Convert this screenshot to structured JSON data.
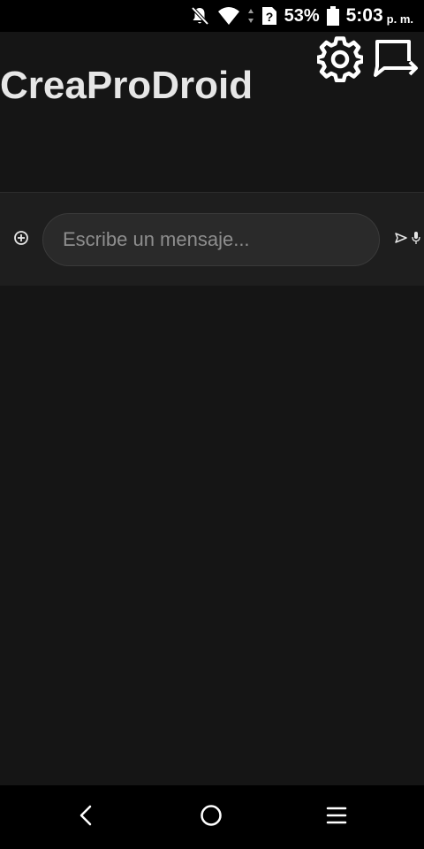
{
  "status_bar": {
    "battery_percent": "53%",
    "time": "5:03",
    "ampm": "p. m.",
    "icons": [
      "notifications-off-icon",
      "wifi-icon",
      "data-arrows-icon",
      "no-sim-icon",
      "battery-icon"
    ]
  },
  "app_bar": {
    "title": "CreaProDroid",
    "actions": [
      "settings-icon",
      "share-chat-icon"
    ]
  },
  "composer": {
    "placeholder": "Escribe un mensaje...",
    "value": "",
    "icons": [
      "add-circle-icon",
      "send-icon",
      "mic-icon"
    ]
  },
  "nav_bar": {
    "icons": [
      "back-icon",
      "home-icon",
      "recents-icon"
    ]
  },
  "colors": {
    "background": "#151515",
    "status_bar": "#000000",
    "composer_bg": "#1e1e1e",
    "input_bg": "#2a2a2a",
    "title_text": "#e6e6e6",
    "placeholder_text": "#8e8e8e"
  }
}
